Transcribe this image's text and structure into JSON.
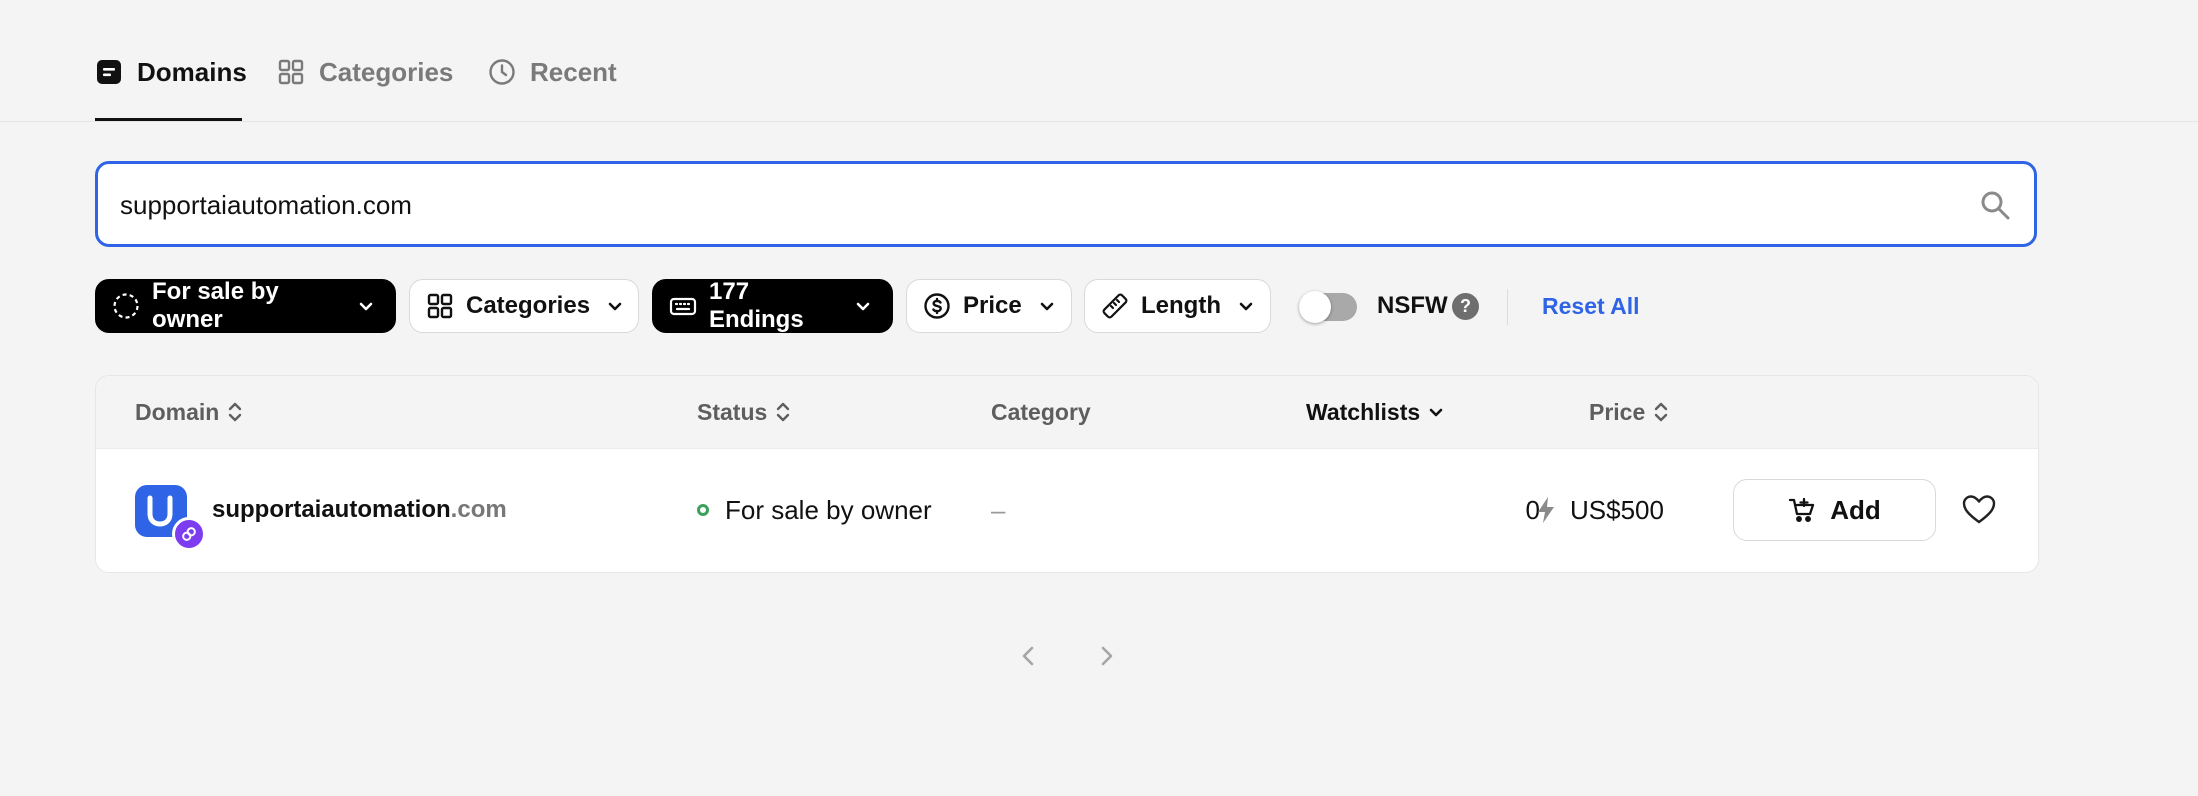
{
  "tabs": [
    {
      "label": "Domains",
      "icon": "domains-icon",
      "active": true
    },
    {
      "label": "Categories",
      "icon": "grid-icon",
      "active": false
    },
    {
      "label": "Recent",
      "icon": "clock-icon",
      "active": false
    }
  ],
  "search": {
    "value": "supportaiautomation.com",
    "icon": "search-icon"
  },
  "filters": {
    "sale_type": "For sale by owner",
    "categories": "Categories",
    "endings": "177 Endings",
    "price": "Price",
    "length": "Length",
    "nsfw_label": "NSFW",
    "nsfw_on": false,
    "help": "?",
    "reset": "Reset All"
  },
  "table": {
    "columns": {
      "domain": "Domain",
      "status": "Status",
      "category": "Category",
      "watchlists": "Watchlists",
      "price": "Price"
    },
    "rows": [
      {
        "domain_name": "supportaiautomation",
        "domain_tld": ".com",
        "status": "For sale by owner",
        "category": "–",
        "watchlists": "0",
        "price": "US$500",
        "add_label": "Add"
      }
    ]
  },
  "colors": {
    "accent": "#2f64e6",
    "status_green": "#3aa05a",
    "chain_badge": "#7d3cf0"
  }
}
